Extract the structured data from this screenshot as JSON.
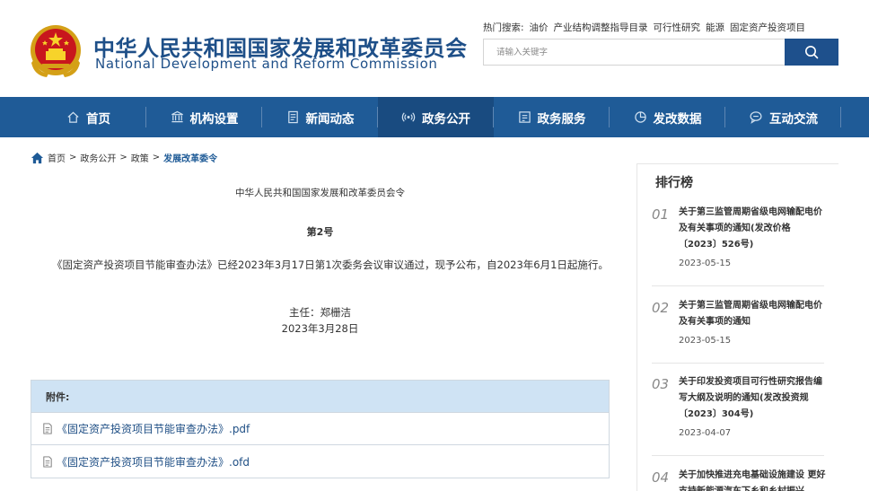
{
  "header": {
    "cn_name": "中华人民共和国国家发展和改革委员会",
    "en_name": "National Development and Reform Commission",
    "hot_label": "热门搜索:",
    "hot_items": [
      "油价",
      "产业结构调整指导目录",
      "可行性研究",
      "能源",
      "固定资产投资项目"
    ],
    "search_placeholder": "请输入关键字"
  },
  "nav": {
    "items": [
      {
        "label": "首页",
        "icon": "home-icon"
      },
      {
        "label": "机构设置",
        "icon": "institution-icon"
      },
      {
        "label": "新闻动态",
        "icon": "news-icon"
      },
      {
        "label": "政务公开",
        "icon": "broadcast-icon"
      },
      {
        "label": "政务服务",
        "icon": "service-icon"
      },
      {
        "label": "发改数据",
        "icon": "pie-chart-icon"
      },
      {
        "label": "互动交流",
        "icon": "chat-icon"
      }
    ],
    "active_index": 3
  },
  "breadcrumb": {
    "items": [
      "首页",
      "政务公开",
      "政策",
      "发展改革委令"
    ],
    "separator": ">"
  },
  "article": {
    "org": "中华人民共和国国家发展和改革委员会令",
    "number": "第2号",
    "body": "《固定资产投资项目节能审查办法》已经2023年3月17日第1次委务会议审议通过，现予公布，自2023年6月1日起施行。",
    "signature": "主任：郑栅洁",
    "date": "2023年3月28日"
  },
  "attachments": {
    "heading": "附件:",
    "files": [
      "《固定资产投资项目节能审查办法》.pdf",
      "《固定资产投资项目节能审查办法》.ofd"
    ]
  },
  "ranking": {
    "title": "排行榜",
    "items": [
      {
        "num": "01",
        "text": "关于第三监管周期省级电网输配电价及有关事项的通知(发改价格〔2023〕526号)",
        "date": "2023-05-15"
      },
      {
        "num": "02",
        "text": "关于第三监管周期省级电网输配电价及有关事项的通知",
        "date": "2023-05-15"
      },
      {
        "num": "03",
        "text": "关于印发投资项目可行性研究报告编写大纲及说明的通知(发改投资规〔2023〕304号)",
        "date": "2023-04-07"
      },
      {
        "num": "04",
        "text": "关于加快推进充电基础设施建设 更好支持新能源汽车下乡和乡村振兴",
        "date": ""
      }
    ]
  },
  "colors": {
    "nav_bg": "#1f5b97",
    "nav_active": "#194b80",
    "brand_blue": "#1e4f88",
    "attach_head": "#cfe3f4"
  }
}
